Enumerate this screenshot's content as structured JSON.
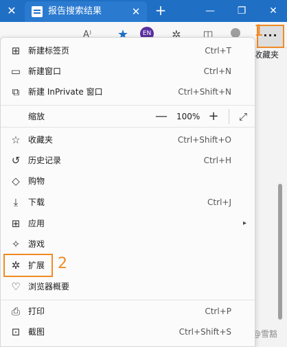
{
  "tab": {
    "title": "报告搜索结果"
  },
  "toolbar": {
    "read_aloud": "A⁾",
    "ext_badge": "EN",
    "more": "···",
    "favorites_label": "收藏夹"
  },
  "annotations": {
    "one": "1",
    "two": "2"
  },
  "menu": {
    "new_tab": {
      "label": "新建标签页",
      "shortcut": "Ctrl+T"
    },
    "new_window": {
      "label": "新建窗口",
      "shortcut": "Ctrl+N"
    },
    "new_inprivate": {
      "label": "新建 InPrivate 窗口",
      "shortcut": "Ctrl+Shift+N"
    },
    "zoom": {
      "label": "缩放",
      "minus": "—",
      "value": "100%",
      "plus": "+"
    },
    "favorites": {
      "label": "收藏夹",
      "shortcut": "Ctrl+Shift+O"
    },
    "history": {
      "label": "历史记录",
      "shortcut": "Ctrl+H"
    },
    "shopping": {
      "label": "购物"
    },
    "downloads": {
      "label": "下载",
      "shortcut": "Ctrl+J"
    },
    "apps": {
      "label": "应用",
      "arrow": "▸"
    },
    "games": {
      "label": "游戏"
    },
    "extensions": {
      "label": "扩展"
    },
    "browser_essentials": {
      "label": "浏览器概要"
    },
    "print": {
      "label": "打印",
      "shortcut": "Ctrl+P"
    },
    "screenshot": {
      "label": "截图",
      "shortcut": "Ctrl+Shift+S"
    }
  },
  "watermark": "知乎 @雪豁",
  "colors": {
    "accent": "#1f6fc5",
    "annotation": "#f08a24"
  }
}
